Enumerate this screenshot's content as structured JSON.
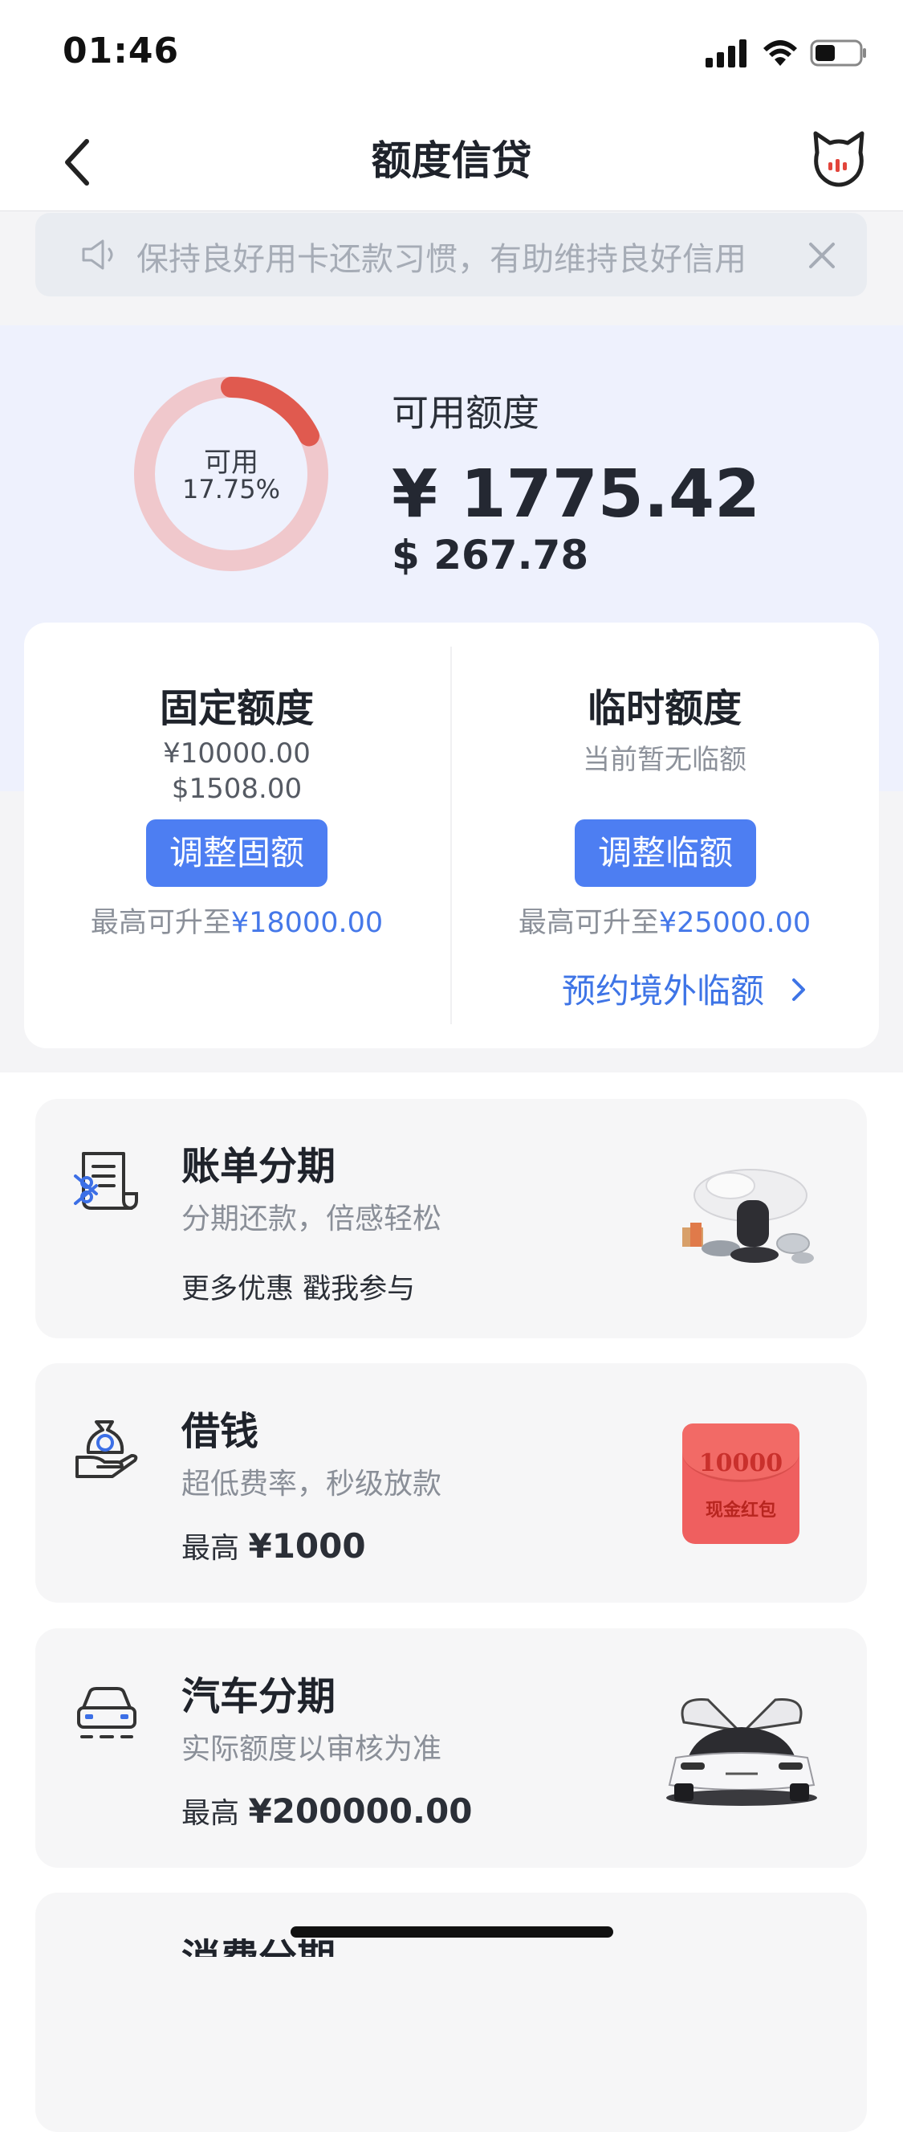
{
  "status_bar": {
    "time": "01:46"
  },
  "nav": {
    "title": "额度信贷"
  },
  "notice": {
    "text": "保持良好用卡还款习惯，有助维持良好信用"
  },
  "overview": {
    "ring_label": "可用",
    "ring_percent": "17.75%",
    "ring_fraction": 0.1775,
    "available_label": "可用额度",
    "available_cny": "¥ 1775.42",
    "available_usd": "$ 267.78"
  },
  "limits": {
    "fixed": {
      "title": "固定额度",
      "cny": "¥10000.00",
      "usd": "$1508.00",
      "button": "调整固额",
      "max_prefix": "最高可升至",
      "max_value": "¥18000.00"
    },
    "temporary": {
      "title": "临时额度",
      "status": "当前暂无临额",
      "button": "调整临额",
      "max_prefix": "最高可升至",
      "max_value": "¥25000.00",
      "overseas_link": "预约境外临额"
    }
  },
  "features": [
    {
      "title": "账单分期",
      "desc": "分期还款，倍感轻松",
      "promo": "更多优惠 戳我参与"
    },
    {
      "title": "借钱",
      "desc": "超低费率，秒级放款",
      "amount_prefix": "最高",
      "amount_value": "¥1000",
      "image_text_1": "10000",
      "image_text_2": "现金红包"
    },
    {
      "title": "汽车分期",
      "desc": "实际额度以审核为准",
      "amount_prefix": "最高",
      "amount_value": "¥200000.00"
    },
    {
      "title": "消费分期"
    }
  ],
  "colors": {
    "accent": "#4d7ef2",
    "ring_used": "#f0c8cc",
    "ring_available": "#e05a4f",
    "overview_bg": "#eef1fd"
  }
}
